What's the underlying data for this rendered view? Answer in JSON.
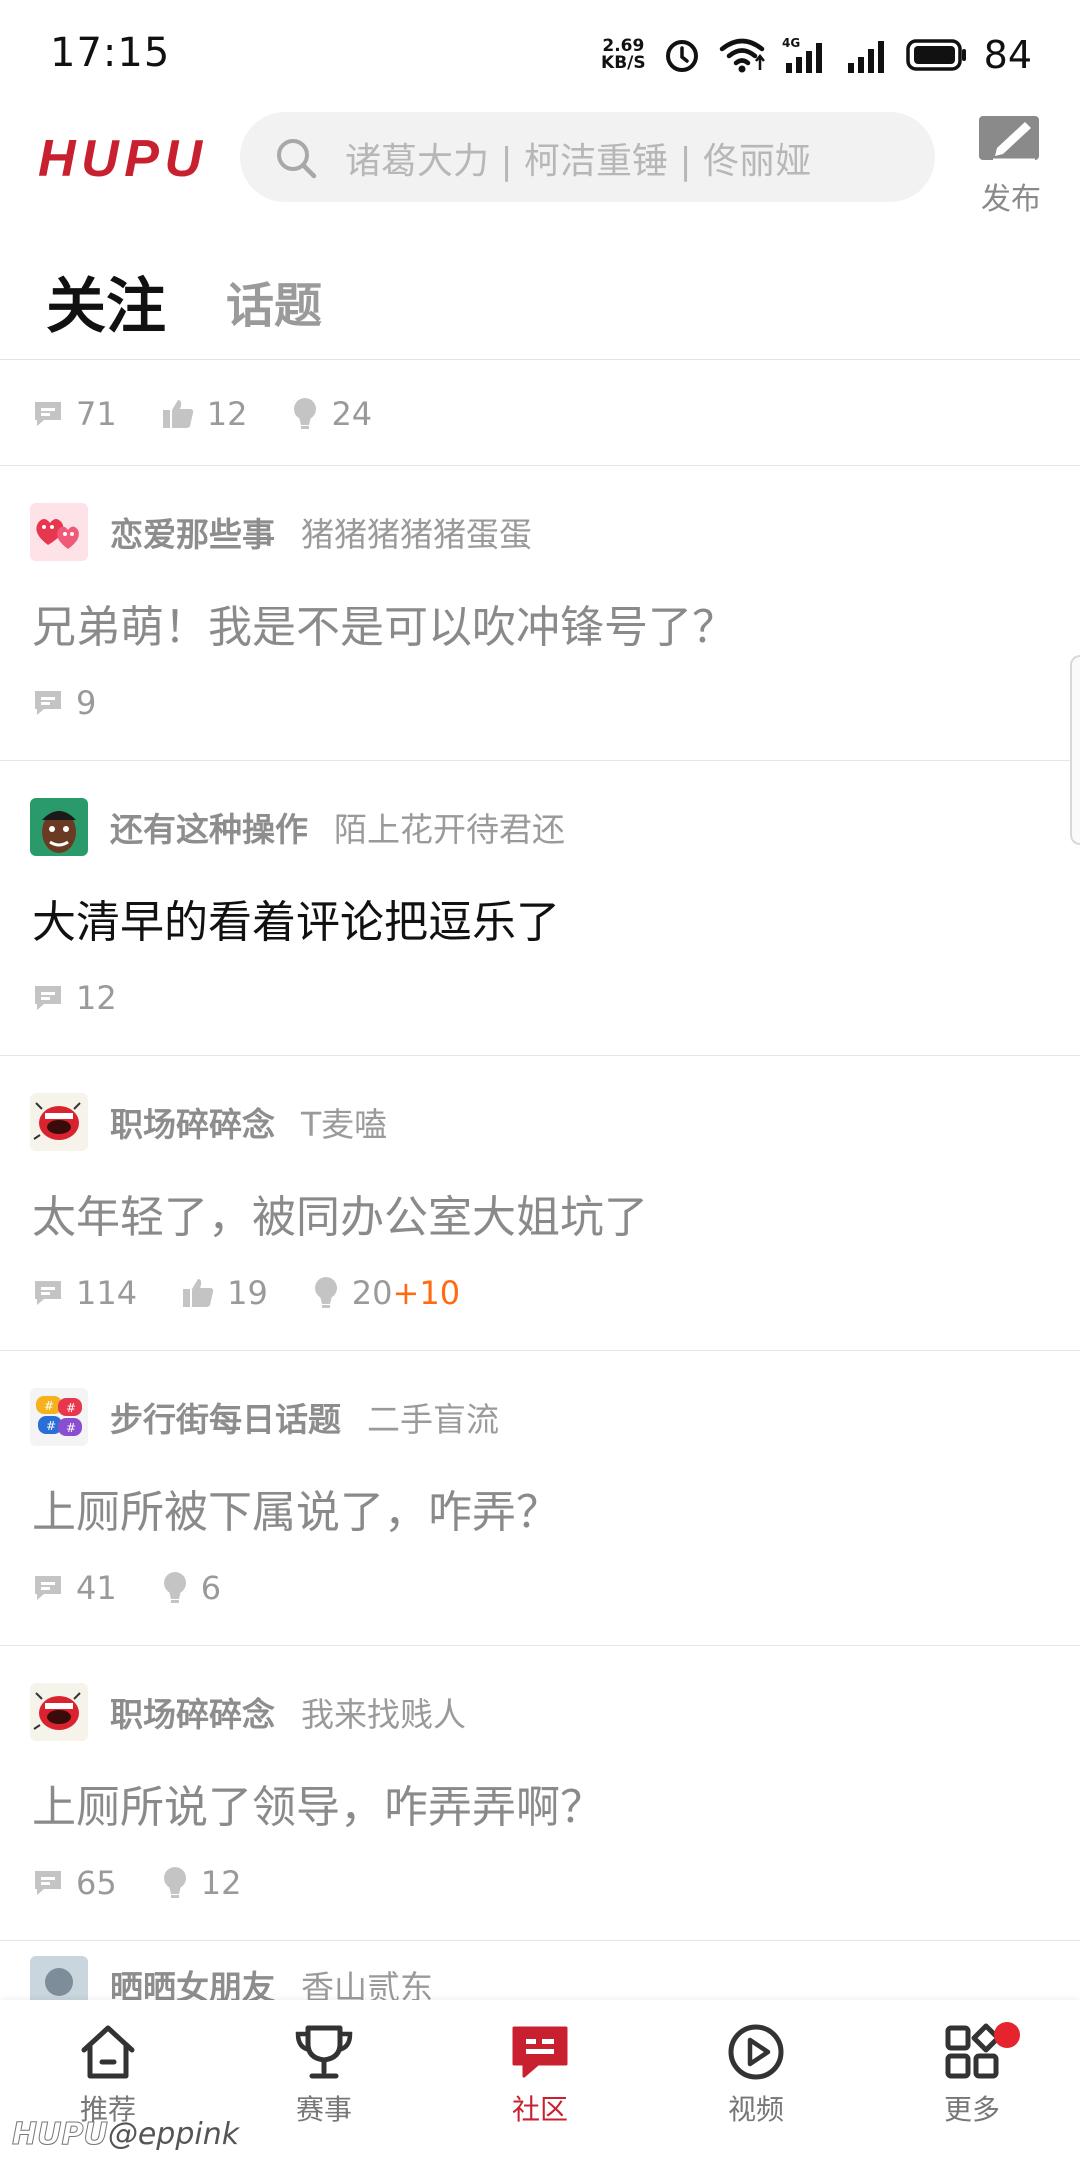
{
  "status_bar": {
    "time": "17:15",
    "net_speed_value": "2.69",
    "net_speed_unit": "KB/S",
    "network": "4G",
    "battery": "84"
  },
  "header": {
    "logo": "HUPU",
    "search_placeholder": "诸葛大力 | 柯洁重锤 | 佟丽娅",
    "publish_label": "发布"
  },
  "tabs": [
    {
      "label": "关注",
      "active": true
    },
    {
      "label": "话题",
      "active": false
    }
  ],
  "feed": {
    "top_stats": {
      "comments": "71",
      "likes": "12",
      "lights": "24"
    },
    "posts": [
      {
        "board": "恋爱那些事",
        "author": "猪猪猪猪猪蛋蛋",
        "title": "兄弟萌！我是不是可以吹冲锋号了？",
        "comments": "9"
      },
      {
        "board": "还有这种操作",
        "author": "陌上花开待君还",
        "title": "大清早的看着评论把逗乐了",
        "comments": "12"
      },
      {
        "board": "职场碎碎念",
        "author": "T麦嗑",
        "title": "太年轻了，被同办公室大姐坑了",
        "comments": "114",
        "likes": "19",
        "lights": "20",
        "lights_bonus": "+10"
      },
      {
        "board": "步行街每日话题",
        "author": "二手盲流",
        "title": "上厕所被下属说了，咋弄？",
        "comments": "41",
        "lights": "6"
      },
      {
        "board": "职场碎碎念",
        "author": "我来找贱人",
        "title": "上厕所说了领导，咋弄弄啊？",
        "comments": "65",
        "lights": "12"
      }
    ],
    "partial_post": {
      "board": "晒晒女朋友",
      "author": "香山贰东"
    }
  },
  "bottom_nav": [
    {
      "label": "推荐",
      "icon": "home-icon"
    },
    {
      "label": "赛事",
      "icon": "trophy-icon"
    },
    {
      "label": "社区",
      "icon": "community-icon",
      "active": true
    },
    {
      "label": "视频",
      "icon": "video-icon"
    },
    {
      "label": "更多",
      "icon": "more-icon"
    }
  ],
  "watermark": {
    "logo": "HUPU",
    "handle": "@eppink"
  },
  "colors": {
    "brand_red": "#c8202f",
    "bonus_orange": "#ff6a13",
    "text_gray": "#9a9a9a",
    "badge_red": "#e5242f"
  }
}
